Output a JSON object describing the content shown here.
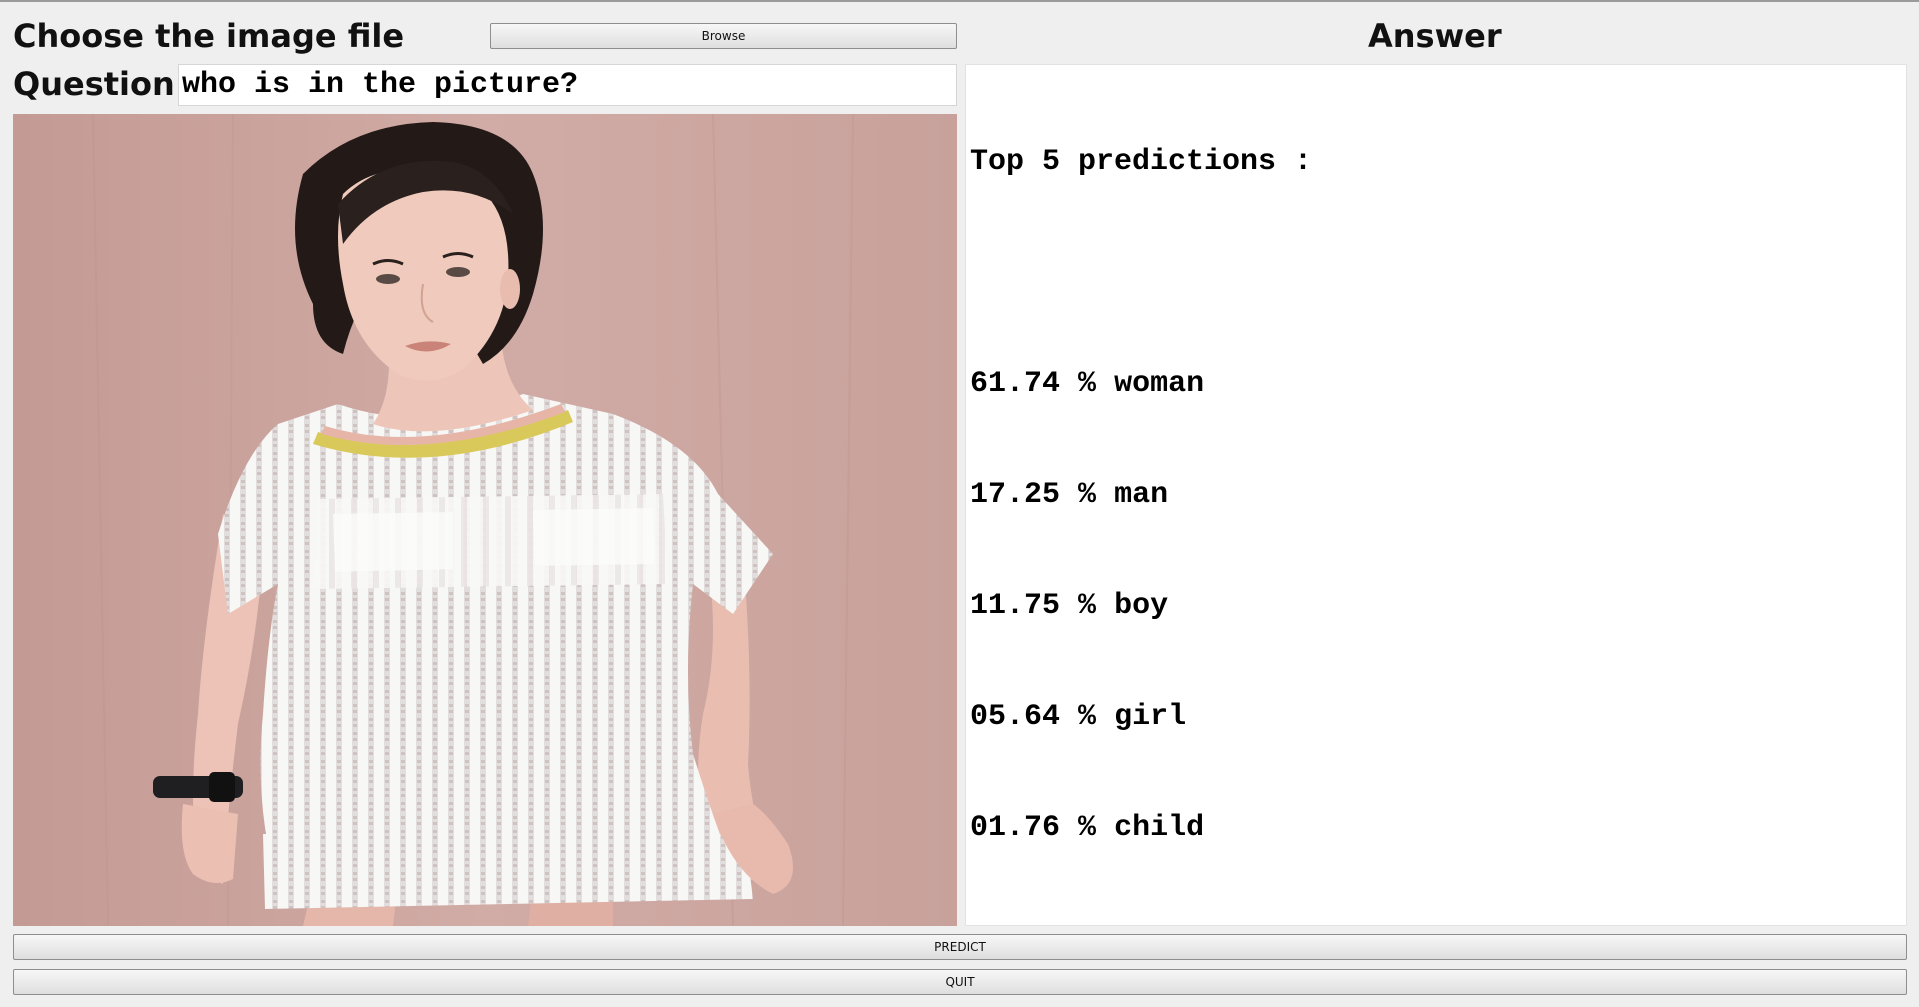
{
  "image_section": {
    "title": "Choose the image file",
    "browse_label": "Browse"
  },
  "question": {
    "label": "Question",
    "value": "who is in the picture?"
  },
  "answer": {
    "title": "Answer",
    "header": "Top 5 predictions :",
    "predictions": [
      {
        "percent": "61.74",
        "unit": "%",
        "label": "woman"
      },
      {
        "percent": "17.25",
        "unit": "%",
        "label": "man"
      },
      {
        "percent": "11.75",
        "unit": "%",
        "label": "boy"
      },
      {
        "percent": "05.64",
        "unit": "%",
        "label": "girl"
      },
      {
        "percent": "01.76",
        "unit": "%",
        "label": "child"
      }
    ]
  },
  "actions": {
    "predict_label": "PREDICT",
    "quit_label": "QUIT"
  },
  "colors": {
    "window_bg": "#efefef",
    "photo_wall": "#c9a39c",
    "dress": "#f6f6f4",
    "collar_yellow": "#e2d85a"
  }
}
